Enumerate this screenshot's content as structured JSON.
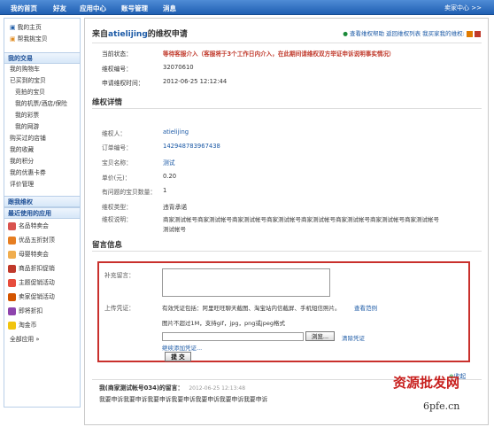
{
  "topnav": {
    "items": [
      "我的首页",
      "好友",
      "应用中心",
      "账号管理",
      "消息"
    ],
    "seller_center": "卖家中心 >>"
  },
  "sidebar": {
    "home": "我的主页",
    "helper": "帮我挑宝贝",
    "trade_head": "我的交易",
    "items": [
      "我的购物车",
      "已买到的宝贝",
      "竞拍的宝贝",
      "我的机票/酒店/保险",
      "我的彩票",
      "我的网游",
      "购买过的店铺",
      "我的收藏",
      "我的积分",
      "我的优惠卡券",
      "评价管理"
    ],
    "follow_head": "跟我维权",
    "apps_head": "最近使用的应用",
    "apps": [
      "名品特卖会",
      "优品五折封顶",
      "母婴特卖会",
      "商品折扣促销",
      "主题促销活动",
      "卖家促销活动",
      "即将折扣",
      "淘金币"
    ],
    "all_apps": "全部应用 »"
  },
  "main": {
    "title_prefix": "来自",
    "title_user": "atielijing",
    "title_suffix": "的维权申请",
    "top_links": "查看维权帮助   返回维权列表   我买家我的维权:",
    "status_label": "当前状态：",
    "status_value": "等待客服介入（客服将于3个工作日内介入，在此期间请维权双方举证申诉说明事实情况）",
    "id_label": "维权编号：",
    "id_value": "32070610",
    "time_label": "申请维权时间：",
    "time_value": "2012-06-25 12:12:44",
    "details_title": "维权详情",
    "details": [
      {
        "label": "维权人：",
        "value": "atielijing"
      },
      {
        "label": "订单编号：",
        "value": "142948783967438"
      },
      {
        "label": "宝贝名称：",
        "value": "测试"
      },
      {
        "label": "单价(元)：",
        "value": "0.20"
      },
      {
        "label": "有问题的宝贝数量：",
        "value": "1"
      },
      {
        "label": "维权类型：",
        "value": "违背承诺"
      },
      {
        "label": "维权说明：",
        "value": "商家测试帐号商家测试帐号商家测试帐号商家测试帐号商家测试帐号商家测试帐号商家测试帐号商家测试帐号"
      },
      {
        "label": "",
        "value": "测试帐号"
      }
    ],
    "message_title": "留言信息",
    "form": {
      "supplement_label": "补充留言：",
      "upload_label": "上传凭证：",
      "upload_hint": "有效凭证包括：阿里旺旺聊天截图、淘宝站内信截屏、手机短信照片。",
      "upload_example": "查看范例",
      "upload_limit": "图片不超过1M，支持gif，jpg，png或jpeg格式",
      "browse": "浏览...",
      "clear": "清除凭证",
      "add_more": "继续添加凭证...",
      "submit": "提 交"
    },
    "collapse": "收起",
    "reply_from": "我(商家测试帐号034)的留言：",
    "reply_time": "2012-06-25 12:13:48",
    "reply_text": "我要申诉我要申诉我要申诉我要申诉我要申诉我要申诉我要申诉"
  },
  "watermark": {
    "text": "资源批发网",
    "url": "6pfe.cn"
  }
}
